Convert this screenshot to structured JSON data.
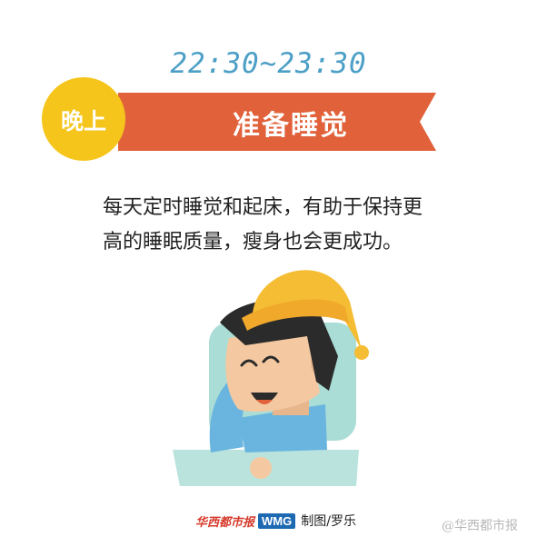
{
  "time_range": "22:30~23:30",
  "badge_label": "晚上",
  "banner_title": "准备睡觉",
  "description": "每天定时睡觉和起床，有助于保持更高的睡眠质量，瘦身也会更成功。",
  "footer": {
    "logo_text": "华西都市报",
    "logo_badge": "WMG",
    "credit": "制图/罗乐"
  },
  "watermark": "@华西都市报",
  "colors": {
    "time_text": "#4c9fc6",
    "ribbon": "#e0613a",
    "badge": "#f5c51c",
    "nightcap": "#f5bd33",
    "pillow": "#a9ddd6",
    "shirt": "#6ab5df",
    "skin": "#f4c9a1",
    "hair": "#2b2b2b"
  }
}
